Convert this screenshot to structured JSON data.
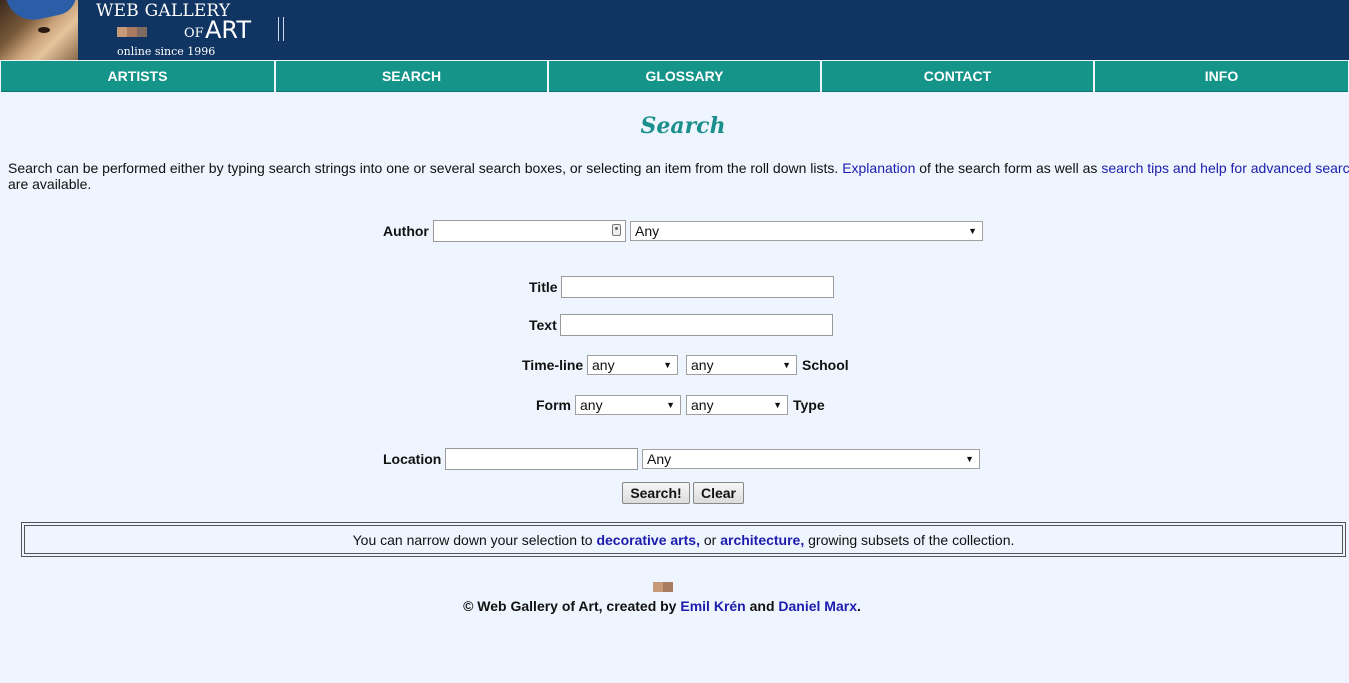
{
  "header": {
    "logo_line1": "WEB GALLERY",
    "logo_of": "OF",
    "logo_art": "ART",
    "logo_since": "online since 1996",
    "logo_square_colors": [
      "#c89a7a",
      "#a97c62",
      "#7f6a60"
    ],
    "background": "#103563"
  },
  "nav": {
    "items": [
      {
        "label": "ARTISTS"
      },
      {
        "label": "SEARCH"
      },
      {
        "label": "GLOSSARY"
      },
      {
        "label": "CONTACT"
      },
      {
        "label": "INFO"
      }
    ],
    "color": "#15948a"
  },
  "page": {
    "title": "Search",
    "intro_text1": "Search can be performed either by typing search strings into one or several search boxes, or selecting an item from the roll down lists. ",
    "intro_link1": "Explanation",
    "intro_text2": " of the search form as well as ",
    "intro_link2": "search tips and help for advanced search",
    "intro_text3": "are available."
  },
  "form": {
    "author_label": "Author",
    "author_value": "",
    "author_select": "Any",
    "title_label": "Title",
    "title_value": "",
    "text_label": "Text",
    "text_value": "",
    "timeline_label": "Time-line",
    "timeline_select": "any",
    "school_select": "any",
    "school_label": "School",
    "form_label": "Form",
    "form_select": "any",
    "type_select": "any",
    "type_label": "Type",
    "location_label": "Location",
    "location_value": "",
    "location_select": "Any",
    "search_button": "Search!",
    "clear_button": "Clear"
  },
  "narrow": {
    "text1": "You can narrow down your selection to ",
    "link1": "decorative arts,",
    "text2": " or ",
    "link2": "architecture,",
    "text3": " growing subsets of the collection."
  },
  "footer": {
    "text1": "© Web Gallery of Art, created by ",
    "link1": "Emil Krén",
    "text2": " and ",
    "link2": "Daniel Marx",
    "text3": "."
  }
}
